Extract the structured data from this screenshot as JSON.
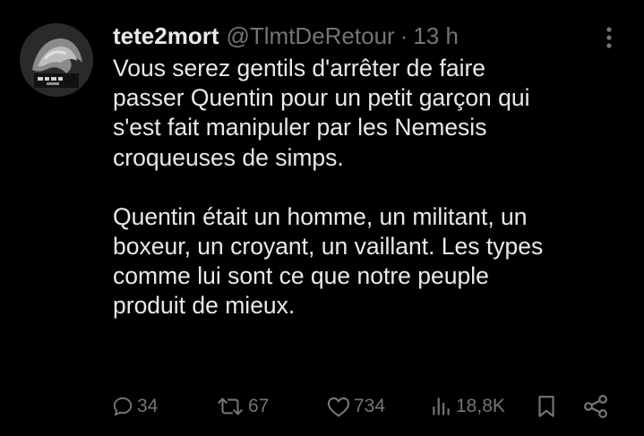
{
  "tweet": {
    "author": {
      "display_name": "tete2mort",
      "handle": "@TlmtDeRetour",
      "avatar_icon": "avatar-profile-picture"
    },
    "separator": "·",
    "time": "13 h",
    "paragraphs": [
      "Vous serez gentils d'arrêter de faire\npasser Quentin pour un petit garçon qui\ns'est fait manipuler par les Nemesis\ncroqueuses de simps.",
      "Quentin était un homme, un militant, un\nboxeur, un croyant, un vaillant. Les types\ncomme lui sont ce que notre peuple\nproduit de mieux."
    ],
    "metrics": {
      "replies": "34",
      "reposts": "67",
      "likes": "734",
      "views": "18,8K"
    },
    "icons": {
      "more": "more-vertical-icon",
      "reply": "reply-icon",
      "repost": "repost-icon",
      "like": "heart-icon",
      "views": "views-icon",
      "bookmark": "bookmark-icon",
      "share": "share-icon"
    },
    "colors": {
      "background": "#000000",
      "text": "#e7e9ea",
      "muted": "#71767b"
    }
  }
}
